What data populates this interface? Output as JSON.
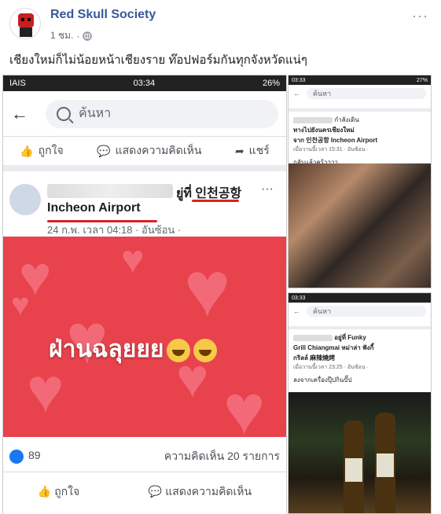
{
  "header": {
    "author": "Red Skull Society",
    "time": "1 ชม.",
    "separator": "·",
    "more": "···"
  },
  "post": {
    "text": "เชียงใหม่ก็ไม่น้อยหน้าเชียงราย ท๊อปฟอร์มกันทุกจังหวัดแน่ๆ"
  },
  "left_shot": {
    "status_left": "IAIS",
    "status_time": "03:34",
    "status_right": "26%",
    "search_placeholder": "ค้นหา",
    "actions": {
      "like": "ถูกใจ",
      "comment": "แสดงความคิดเห็น",
      "share": "แชร์"
    },
    "sub_post": {
      "location_prefix": "ยู่ที่",
      "location": "인천공항",
      "location_en": "Incheon Airport",
      "time": "24 ก.พ. เวลา 04:18 · อันซ้อน ·",
      "more": "···"
    },
    "image_caption": "ฝ่านฉลุยยย",
    "reactions": {
      "like_count": "89",
      "comment_count": "ความคิดเห็น 20 รายการ"
    },
    "bottom_actions": {
      "like": "ถูกใจ",
      "comment": "แสดงความคิดเห็น"
    }
  },
  "right_top": {
    "status_time": "03:33",
    "status_right": "27%",
    "search_placeholder": "ค้นหา",
    "status_line": "กำลังเดิน",
    "title_line1": "ทางไปยังนครเชียงใหม่",
    "title_line2": "จาก 인천공항 Incheon Airport",
    "time": "เมื่อวานนี้เวลา 15:31 · อันซ้อน ·",
    "body": "กลับแล้วคร้าาาา"
  },
  "right_bottom": {
    "status_time": "03:33",
    "search_placeholder": "ค้นหา",
    "line1": "อยู่ที่ Funky",
    "line2": "Grill Chiangmai หม่าล่า ฟังกี้",
    "line3": "กริลล์ 麻辣燒烤",
    "time": "เมื่อวานนี้เวลา 23:25 · อันซ้อน ·",
    "body": "ลงจากเครื่องปุ๊ปกินปั๊ป"
  }
}
